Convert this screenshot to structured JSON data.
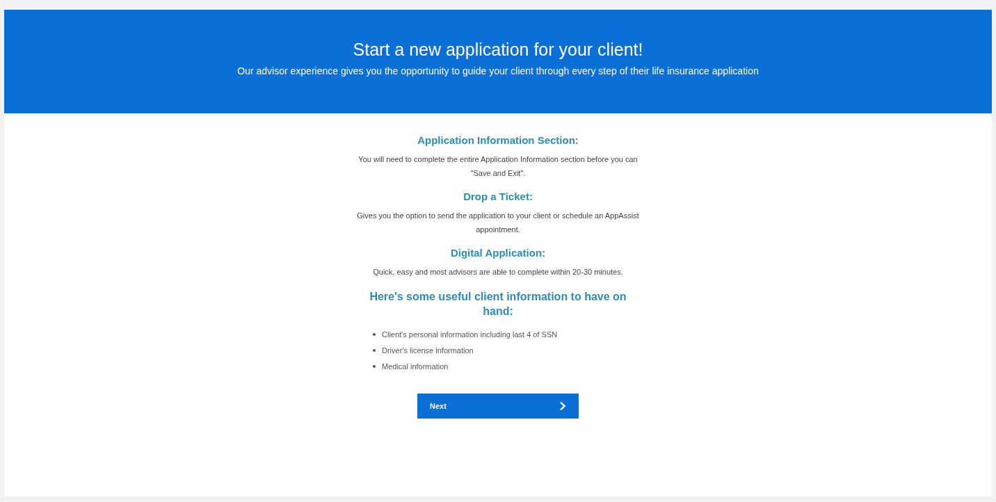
{
  "banner": {
    "title": "Start a new application for your client!",
    "subtitle": "Our advisor experience gives you the opportunity to guide your client through every step of their life insurance application"
  },
  "sections": [
    {
      "heading": "Application Information Section:",
      "text": "You will need to complete the entire Application Information section before you can \"Save and Exit\"."
    },
    {
      "heading": "Drop a Ticket:",
      "text": "Gives you the option to send the application to your client or schedule an AppAssist appointment."
    },
    {
      "heading": "Digital Application:",
      "text": "Quick, easy and most advisors are able to complete within 20-30 minutes."
    }
  ],
  "checklist": {
    "heading": "Here's some useful client information to have on hand:",
    "items": [
      "Client's personal information including last 4 of SSN",
      "Driver's license information",
      "Medical information"
    ]
  },
  "next_button": {
    "label": "Next"
  }
}
